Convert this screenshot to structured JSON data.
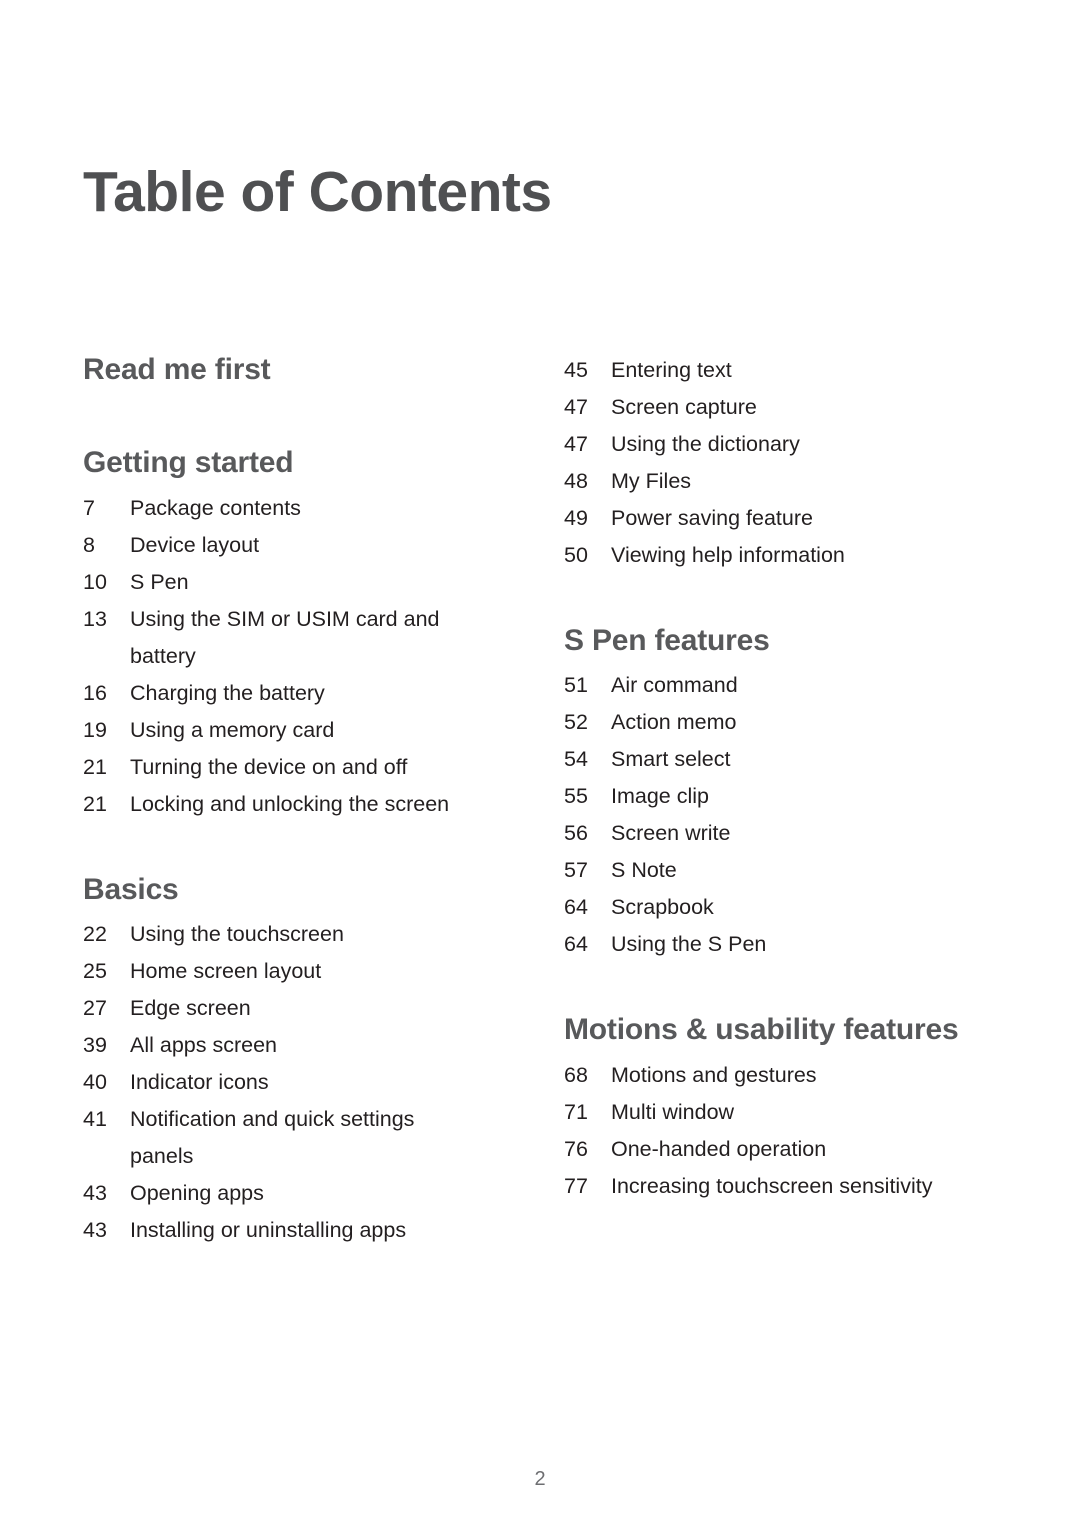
{
  "document": {
    "title": "Table of Contents",
    "page_number": "2",
    "colors": {
      "heading": "#58595b",
      "title": "#4f5052",
      "body": "#231f20",
      "page_number": "#6d6e71",
      "background": "#ffffff"
    }
  },
  "columns": [
    {
      "name": "left-column",
      "sections": [
        {
          "heading": "Read me first",
          "entries": []
        },
        {
          "heading": "Getting started",
          "entries": [
            {
              "page": "7",
              "title": "Package contents"
            },
            {
              "page": "8",
              "title": "Device layout"
            },
            {
              "page": "10",
              "title": "S Pen"
            },
            {
              "page": "13",
              "title": "Using the SIM or USIM card and battery"
            },
            {
              "page": "16",
              "title": "Charging the battery"
            },
            {
              "page": "19",
              "title": "Using a memory card"
            },
            {
              "page": "21",
              "title": "Turning the device on and off"
            },
            {
              "page": "21",
              "title": "Locking and unlocking the screen"
            }
          ]
        },
        {
          "heading": "Basics",
          "entries": [
            {
              "page": "22",
              "title": "Using the touchscreen"
            },
            {
              "page": "25",
              "title": "Home screen layout"
            },
            {
              "page": "27",
              "title": "Edge screen"
            },
            {
              "page": "39",
              "title": "All apps screen"
            },
            {
              "page": "40",
              "title": "Indicator icons"
            },
            {
              "page": "41",
              "title": "Notification and quick settings panels"
            },
            {
              "page": "43",
              "title": "Opening apps"
            },
            {
              "page": "43",
              "title": "Installing or uninstalling apps"
            }
          ]
        }
      ]
    },
    {
      "name": "right-column",
      "sections": [
        {
          "heading": "",
          "entries": [
            {
              "page": "45",
              "title": "Entering text"
            },
            {
              "page": "47",
              "title": "Screen capture"
            },
            {
              "page": "47",
              "title": "Using the dictionary"
            },
            {
              "page": "48",
              "title": "My Files"
            },
            {
              "page": "49",
              "title": "Power saving feature"
            },
            {
              "page": "50",
              "title": "Viewing help information"
            }
          ]
        },
        {
          "heading": "S Pen features",
          "entries": [
            {
              "page": "51",
              "title": "Air command"
            },
            {
              "page": "52",
              "title": "Action memo"
            },
            {
              "page": "54",
              "title": "Smart select"
            },
            {
              "page": "55",
              "title": "Image clip"
            },
            {
              "page": "56",
              "title": "Screen write"
            },
            {
              "page": "57",
              "title": "S Note"
            },
            {
              "page": "64",
              "title": "Scrapbook"
            },
            {
              "page": "64",
              "title": "Using the S Pen"
            }
          ]
        },
        {
          "heading": "Motions & usability features",
          "entries": [
            {
              "page": "68",
              "title": "Motions and gestures"
            },
            {
              "page": "71",
              "title": "Multi window"
            },
            {
              "page": "76",
              "title": "One-handed operation"
            },
            {
              "page": "77",
              "title": "Increasing touchscreen sensitivity"
            }
          ]
        }
      ]
    }
  ]
}
